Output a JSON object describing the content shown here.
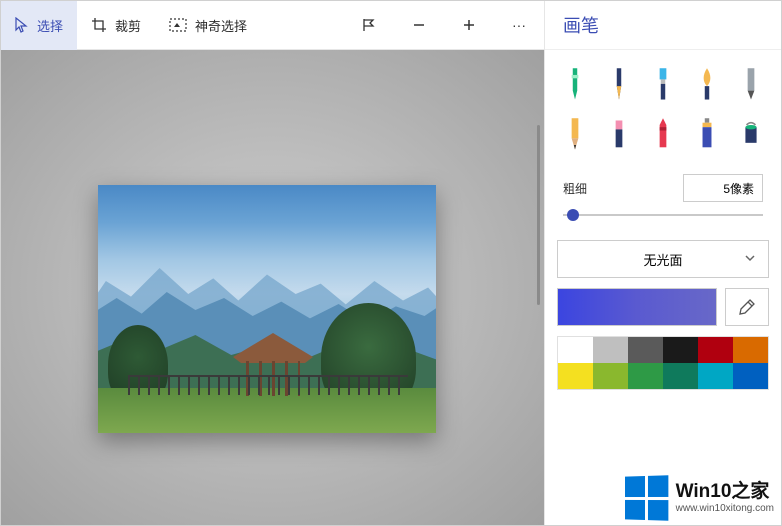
{
  "toolbar": {
    "select": "选择",
    "crop": "裁剪",
    "magic_select": "神奇选择",
    "more": "···"
  },
  "panel": {
    "title": "画笔",
    "thickness_label": "粗细",
    "thickness_value": "5像素",
    "surface_label": "无光面"
  },
  "brushes": [
    "marker",
    "calligraphy-pen",
    "paintbrush",
    "oil-brush",
    "pencil-tip",
    "pencil",
    "eraser",
    "crayon",
    "spray-can",
    "paint-bucket"
  ],
  "palette": [
    "#ffffff",
    "#c0c0c0",
    "#606060",
    "#202020",
    "#b00010",
    "#d06000",
    "#f0e020",
    "#70c030",
    "#30a050",
    "#108060",
    "#00b0c0",
    "#0060c0"
  ],
  "current_color": "linear-gradient(to right,#3b45e0,#6868c8)",
  "watermark": {
    "title": "Win10之家",
    "url": "www.win10xitong.com"
  }
}
